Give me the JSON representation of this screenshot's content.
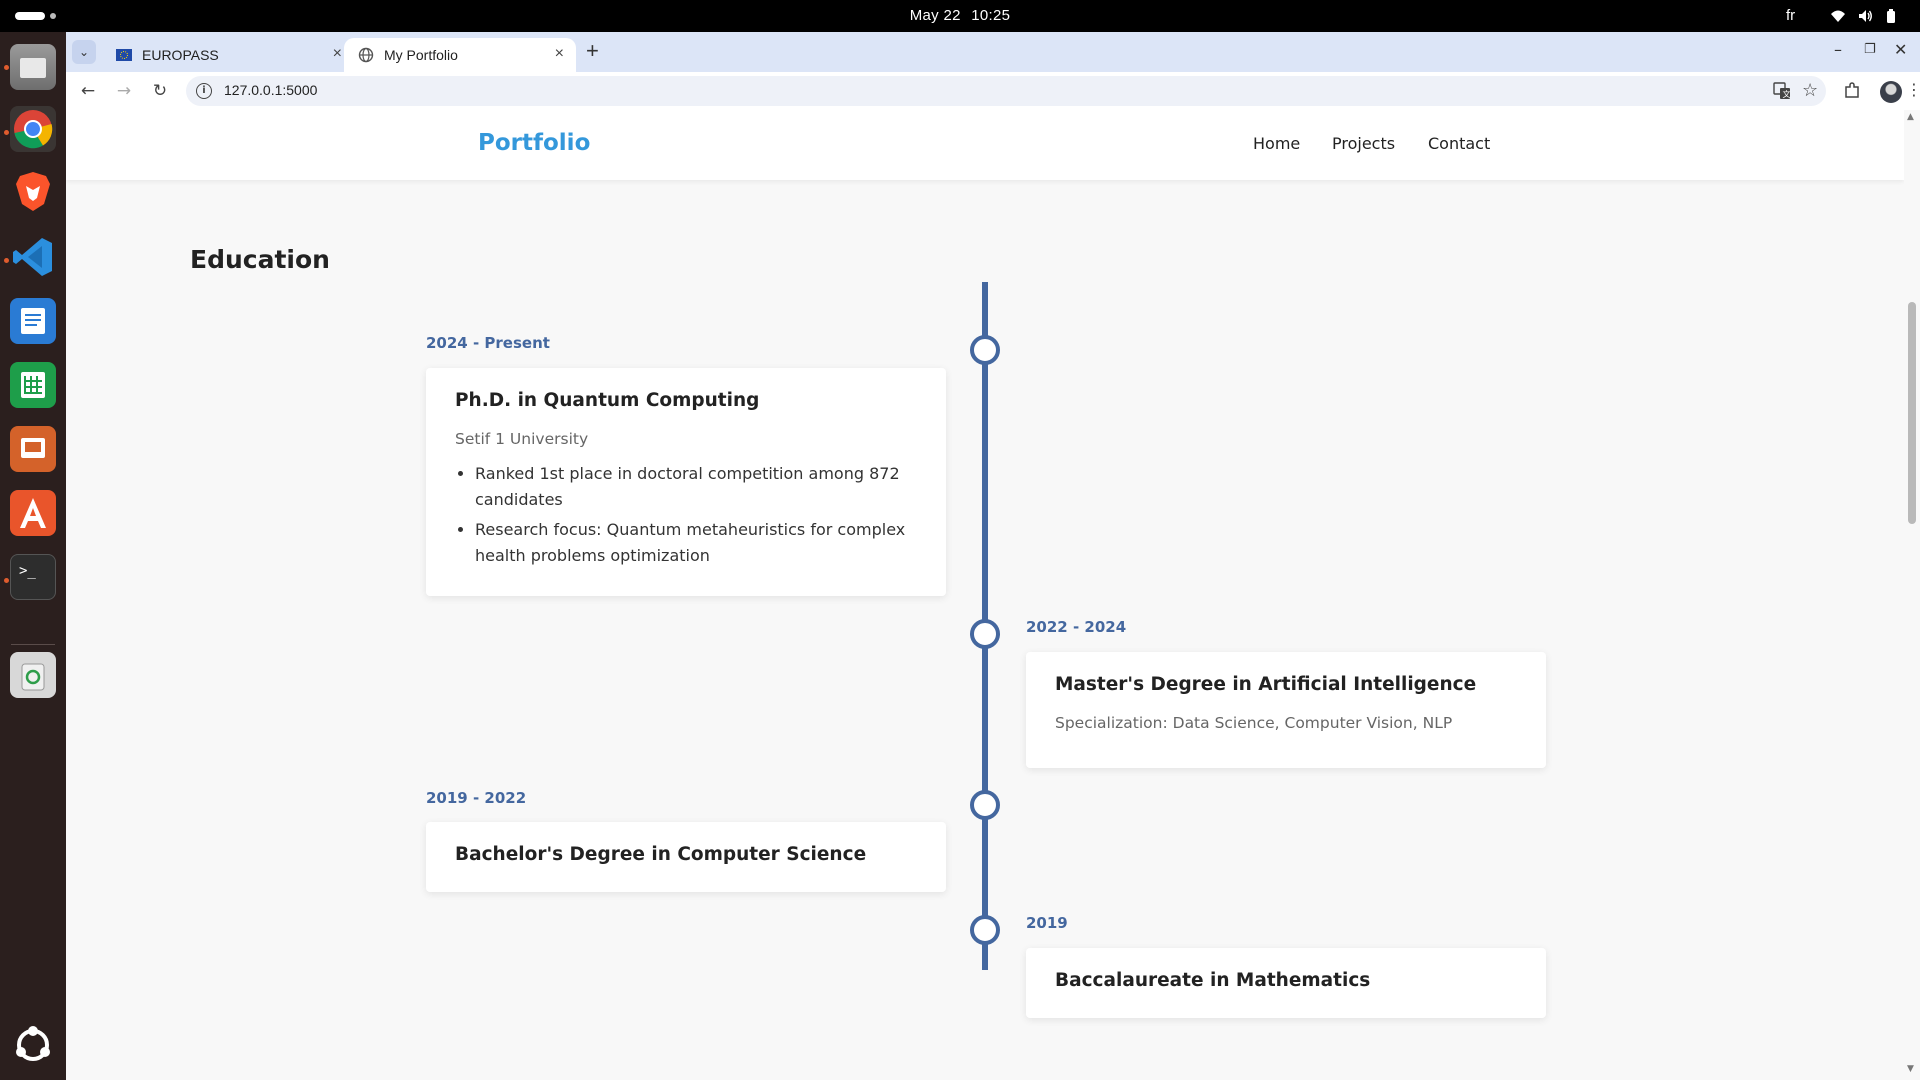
{
  "system": {
    "date": "May 22",
    "time": "10:25",
    "input_language": "fr"
  },
  "dock": {
    "apps": [
      "files-icon",
      "chrome-icon",
      "brave-icon",
      "vscode-icon",
      "writer-icon",
      "calc-icon",
      "impress-icon",
      "app-center-icon",
      "terminal-icon",
      "trash-icon",
      "show-apps-icon"
    ]
  },
  "browser": {
    "tabs": [
      {
        "title": "EUROPASS",
        "active": false
      },
      {
        "title": "My Portfolio",
        "active": true
      }
    ],
    "url": "127.0.0.1:5000"
  },
  "site": {
    "brand": "Portfolio",
    "nav": [
      "Home",
      "Projects",
      "Contact"
    ],
    "accent_color": "#3498db",
    "timeline_color": "#44679f"
  },
  "education": {
    "title": "Education",
    "items": [
      {
        "period": "2024 - Present",
        "degree": "Ph.D. in Quantum Computing",
        "institution": "Setif 1 University",
        "details": [
          "Ranked 1st place in doctoral competition among 872 candidates",
          "Research focus: Quantum metaheuristics for complex health problems optimization"
        ]
      },
      {
        "period": "2022 - 2024",
        "degree": "Master's Degree in Artificial Intelligence",
        "specialization": "Specialization: Data Science, Computer Vision, NLP"
      },
      {
        "period": "2019 - 2022",
        "degree": "Bachelor's Degree in Computer Science"
      },
      {
        "period": "2019",
        "degree": "Baccalaureate in Mathematics"
      }
    ]
  }
}
